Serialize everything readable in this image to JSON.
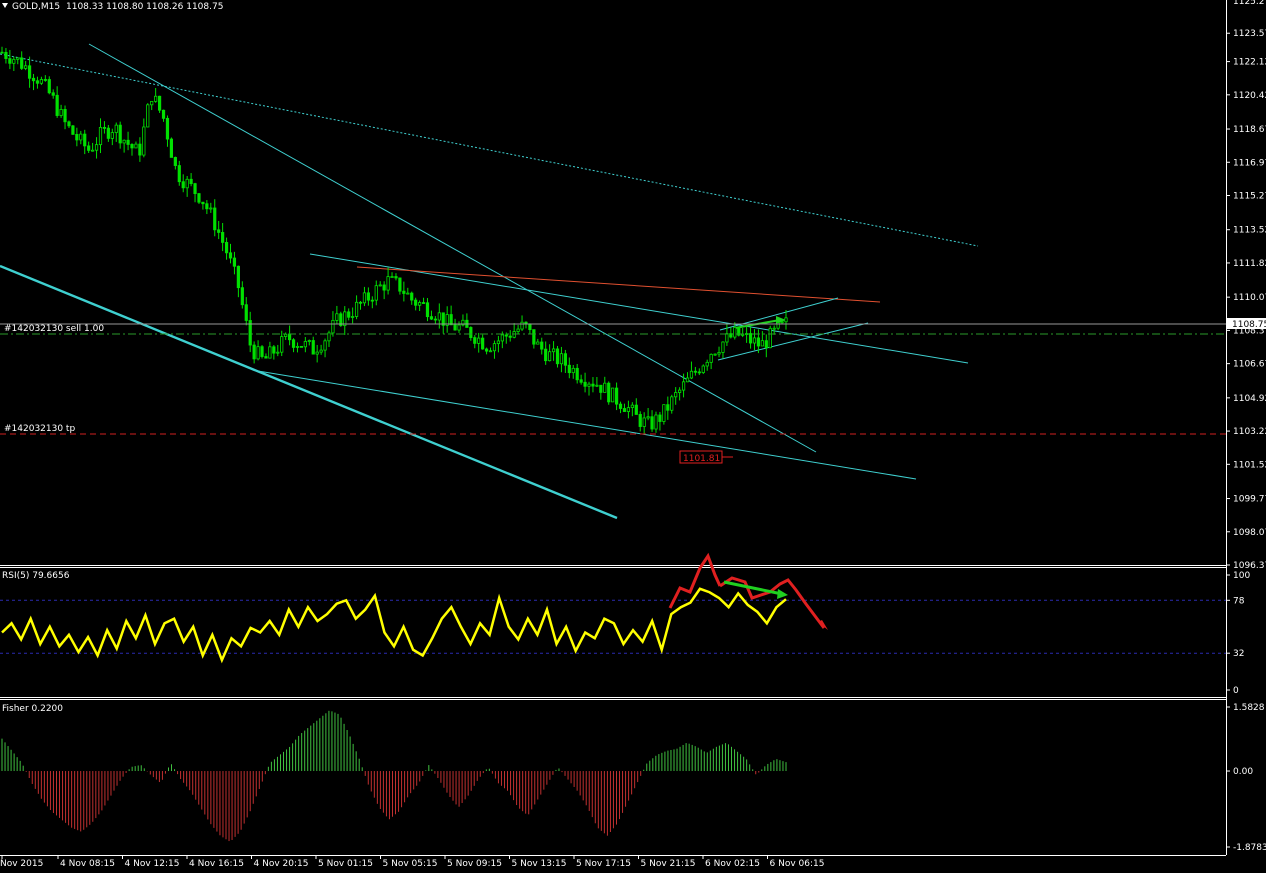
{
  "header": {
    "symbol_label": "GOLD,M15",
    "ohlc": "1108.33 1108.80 1108.26 1108.75"
  },
  "colors": {
    "background": "#000000",
    "candle": "#00e000",
    "trendline": "#3fd0d0",
    "red": "#e02020",
    "rsi_line": "#ffff00",
    "fisher_up": "#40c040",
    "fisher_down": "#c03030",
    "arrow_green": "#20d020"
  },
  "orders": {
    "sell_label": "#142032130 sell 1.00",
    "tp_label": "#142032130 tp",
    "tp_price_box": "1101.81"
  },
  "price_axis": {
    "ticks": [
      "1123.57",
      "1122.12",
      "1120.42",
      "1118.67",
      "1116.97",
      "1115.27",
      "1113.52",
      "1111.82",
      "1110.07",
      "1108.37",
      "1106.67",
      "1104.92",
      "1103.22",
      "1101.52",
      "1099.77",
      "1098.07",
      "1096.37"
    ],
    "current_price": "1108.75",
    "top_partial": "1125.27"
  },
  "rsi": {
    "label": "RSI(5) 79.6656",
    "levels": [
      "100",
      "78",
      "32",
      "0"
    ]
  },
  "fisher": {
    "label": "Fisher 0.2200",
    "levels": [
      "1.5828",
      "0.00",
      "-1.8783"
    ]
  },
  "time_axis": {
    "labels": [
      "Nov 2015",
      "4 Nov 08:15",
      "4 Nov 12:15",
      "4 Nov 16:15",
      "4 Nov 20:15",
      "5 Nov 01:15",
      "5 Nov 05:15",
      "5 Nov 09:15",
      "5 Nov 13:15",
      "5 Nov 17:15",
      "5 Nov 21:15",
      "6 Nov 02:15",
      "6 Nov 06:15"
    ]
  },
  "chart_data": [
    {
      "type": "candlestick",
      "symbol": "GOLD",
      "timeframe": "M15",
      "ylim": [
        1096.37,
        1125.27
      ],
      "close_path": [
        1122.6,
        1122.3,
        1121.8,
        1121.2,
        1120.3,
        1119.0,
        1118.2,
        1117.6,
        1118.4,
        1118.8,
        1118.0,
        1117.4,
        1120.5,
        1119.2,
        1116.5,
        1115.8,
        1115.2,
        1114.0,
        1112.5,
        1110.6,
        1107.5,
        1106.8,
        1107.4,
        1108.0,
        1107.7,
        1107.4,
        1108.0,
        1108.9,
        1109.3,
        1109.8,
        1110.4,
        1110.9,
        1110.6,
        1109.9,
        1109.6,
        1109.2,
        1108.6,
        1108.5,
        1108.1,
        1107.6,
        1107.9,
        1108.3,
        1108.6,
        1107.6,
        1107.1,
        1106.8,
        1106.3,
        1105.9,
        1105.6,
        1105.0,
        1104.6,
        1103.9,
        1103.5,
        1104.0,
        1104.9,
        1105.7,
        1106.5,
        1107.3,
        1107.8,
        1108.2,
        1107.9,
        1107.6,
        1108.2,
        1108.7
      ],
      "current_price": 1108.75
    },
    {
      "type": "line",
      "name": "RSI(5)",
      "ylim": [
        0,
        100
      ],
      "levels": [
        78,
        32
      ],
      "last_value": 79.6656,
      "values": [
        50,
        58,
        44,
        62,
        40,
        55,
        38,
        48,
        33,
        46,
        30,
        52,
        36,
        60,
        45,
        65,
        40,
        58,
        62,
        42,
        55,
        30,
        48,
        26,
        45,
        38,
        54,
        50,
        60,
        48,
        70,
        55,
        72,
        60,
        66,
        75,
        78,
        62,
        70,
        82,
        50,
        38,
        55,
        35,
        30,
        45,
        62,
        72,
        55,
        40,
        58,
        48,
        80,
        55,
        44,
        62,
        48,
        70,
        40,
        55,
        34,
        50,
        45,
        62,
        58,
        40,
        52,
        42,
        60,
        35,
        66,
        72,
        76,
        88,
        85,
        80,
        72,
        84,
        74,
        68,
        58,
        72,
        79
      ]
    },
    {
      "type": "bar",
      "name": "Fisher",
      "ylim": [
        -1.8783,
        1.5828
      ],
      "last_value": 0.22,
      "values": [
        0.8,
        0.5,
        0.2,
        -0.3,
        -0.7,
        -1.0,
        -1.2,
        -1.4,
        -1.5,
        -1.3,
        -1.0,
        -0.6,
        -0.2,
        0.1,
        0.15,
        -0.1,
        -0.3,
        0.2,
        -0.2,
        -0.5,
        -0.9,
        -1.3,
        -1.6,
        -1.75,
        -1.5,
        -1.0,
        -0.4,
        0.2,
        0.4,
        0.6,
        0.9,
        1.1,
        1.3,
        1.5,
        1.4,
        0.9,
        0.3,
        -0.4,
        -0.9,
        -1.2,
        -1.0,
        -0.6,
        -0.3,
        0.15,
        -0.2,
        -0.6,
        -0.9,
        -0.6,
        -0.2,
        0.1,
        -0.3,
        -0.5,
        -0.9,
        -1.1,
        -0.7,
        -0.3,
        0.1,
        -0.2,
        -0.5,
        -0.9,
        -1.4,
        -1.6,
        -1.3,
        -0.8,
        -0.3,
        0.2,
        0.4,
        0.5,
        0.55,
        0.7,
        0.6,
        0.45,
        0.6,
        0.7,
        0.5,
        0.3,
        -0.1,
        0.15,
        0.3,
        0.22
      ]
    }
  ]
}
